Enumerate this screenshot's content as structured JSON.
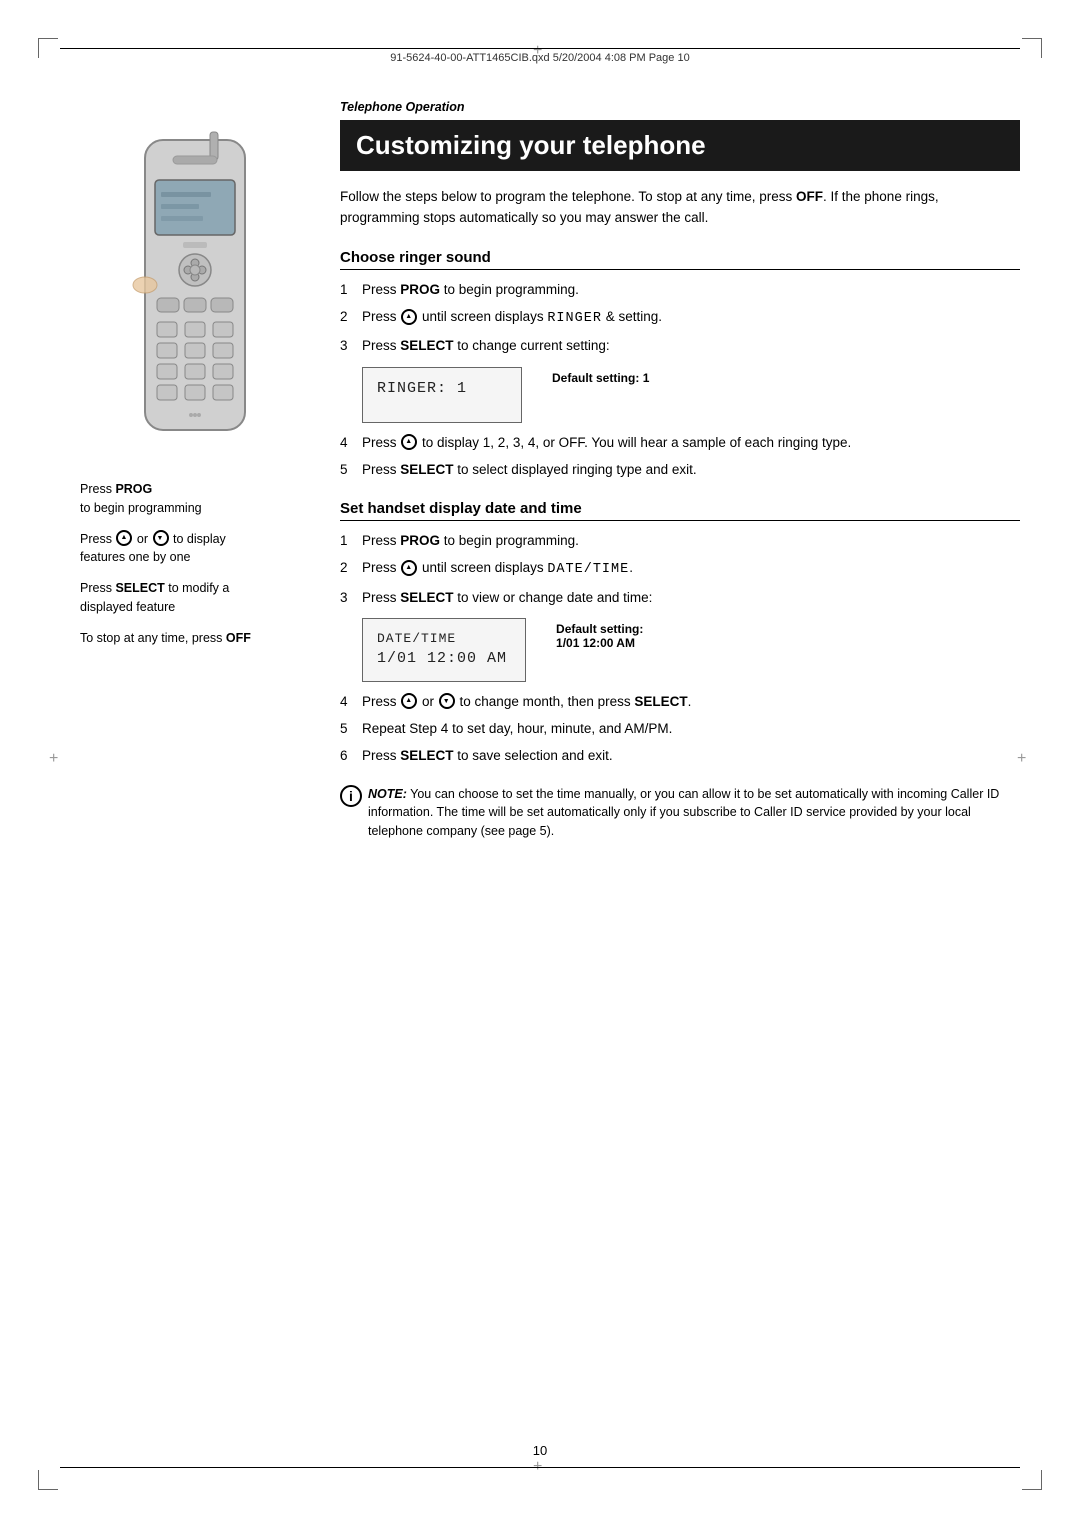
{
  "header": {
    "file_info": "91-5624-40-00-ATT1465CIB.qxd  5/20/2004  4:08 PM  Page 10"
  },
  "left_column": {
    "press_prog_label": "Press ",
    "press_prog_bold": "PROG",
    "press_prog_desc": "to begin programming",
    "press_arrows_label": "Press ",
    "press_arrows_desc": " to display\nfeatures one by one",
    "press_select_label": "Press ",
    "press_select_bold": "SELECT",
    "press_select_desc": " to modify a\ndisplayed feature",
    "press_off_label": "To stop at any time, press ",
    "press_off_bold": "OFF"
  },
  "right_column": {
    "telephone_operation": "Telephone Operation",
    "section_title": "Customizing your telephone",
    "intro_text": "Follow the steps below to program the telephone. To stop at any time, press OFF. If the phone rings, programming stops automatically so you may answer the call.",
    "intro_off_bold": "OFF",
    "section1": {
      "heading": "Choose ringer sound",
      "steps": [
        {
          "num": "1",
          "text_before": "Press ",
          "bold": "PROG",
          "text_after": " to begin programming."
        },
        {
          "num": "2",
          "text_before": "Press ",
          "text_after": " until screen displays ",
          "display_text": "RINGER",
          "text_end": " & setting."
        },
        {
          "num": "3",
          "text_before": "Press ",
          "bold": "SELECT",
          "text_after": " to change current setting:"
        },
        {
          "num": "4",
          "text_before": "Press ",
          "text_after": " to display 1, 2, 3, 4, or OFF. You will hear a sample of each ringing type."
        },
        {
          "num": "5",
          "text_before": "Press ",
          "bold": "SELECT",
          "text_after": " to select displayed ringing type and exit."
        }
      ],
      "display_box": {
        "line1": "RINGER: 1"
      },
      "default_setting_label": "Default setting:",
      "default_setting_value": "1"
    },
    "section2": {
      "heading": "Set handset display date and time",
      "steps": [
        {
          "num": "1",
          "text_before": "Press ",
          "bold": "PROG",
          "text_after": " to begin programming."
        },
        {
          "num": "2",
          "text_before": "Press ",
          "text_after": " until screen displays ",
          "display_text": "DATE/TIME",
          "text_end": "."
        },
        {
          "num": "3",
          "text_before": "Press ",
          "bold": "SELECT",
          "text_after": " to view or change date and time:"
        },
        {
          "num": "4",
          "text_before": "Press ",
          "text_middle": " or ",
          "text_after": " to change month, then press ",
          "bold_end": "SELECT",
          "text_final": "."
        },
        {
          "num": "5",
          "text": "Repeat Step 4 to set day, hour, minute, and AM/PM."
        },
        {
          "num": "6",
          "text_before": "Press ",
          "bold": "SELECT",
          "text_after": " to save selection and exit."
        }
      ],
      "display_box": {
        "line1": "DATE/TIME",
        "line2": "1/01  12:00 AM"
      },
      "default_setting_label": "Default setting:",
      "default_setting_value": "1/01 12:00 AM"
    },
    "note": {
      "label": "NOTE:",
      "text": " You can choose to set the time manually, or you can allow it to be set automatically with incoming Caller ID information. The time will be set automatically only if you subscribe to Caller ID service provided by your local telephone company (see page 5)."
    }
  },
  "footer": {
    "page_number": "10"
  }
}
